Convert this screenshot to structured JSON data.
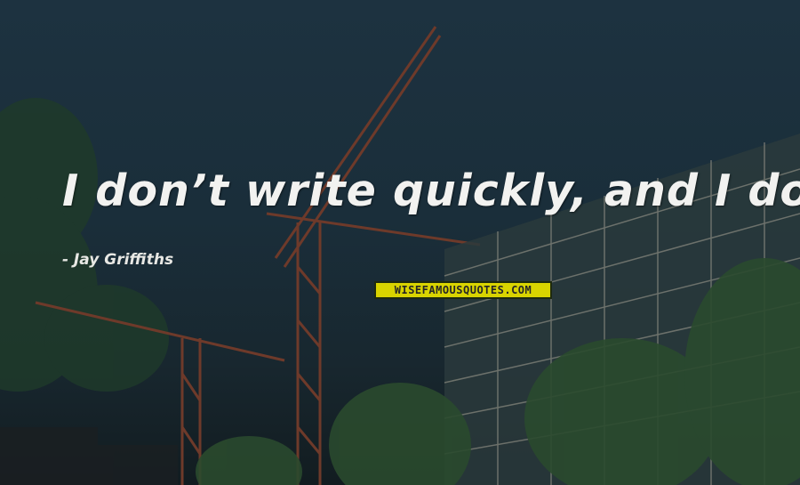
{
  "quote": {
    "text": "I don’t write quickly, and I don’t want to."
  },
  "author": {
    "text": "- Jay Griffiths"
  },
  "watermark": {
    "text": "WISEFAMOUSQUOTES.COM"
  },
  "colors": {
    "sky": "#1d3240",
    "watermark_bg": "#d9d400",
    "text": "#f2f2f0",
    "crane": "#6e3a2a"
  }
}
